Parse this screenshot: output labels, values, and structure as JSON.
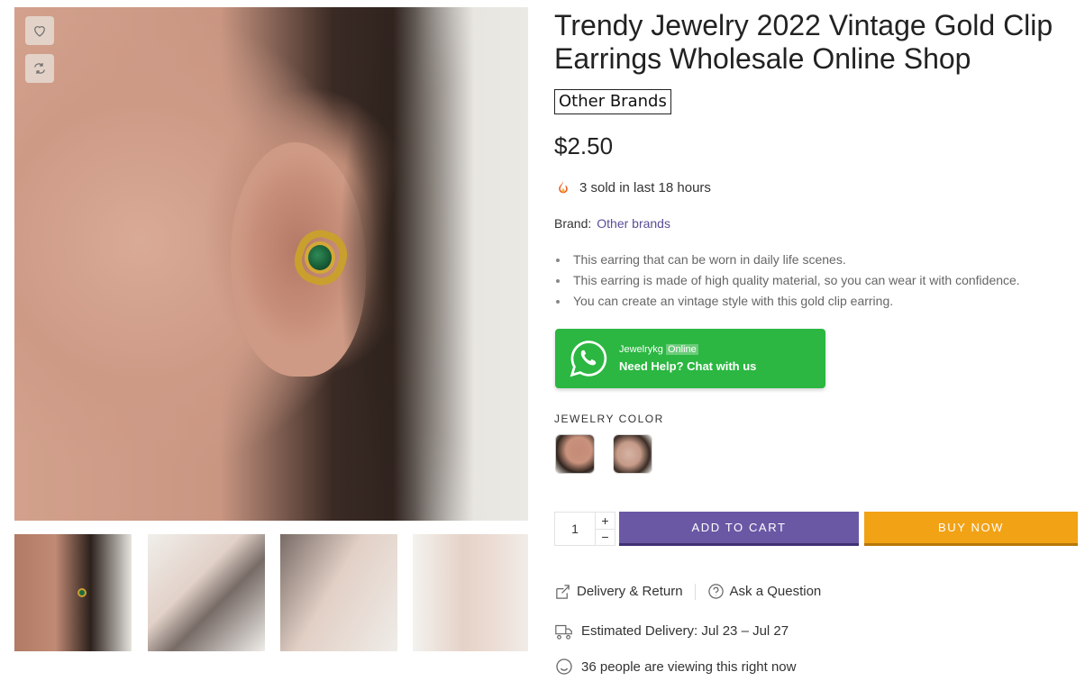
{
  "product": {
    "title": "Trendy Jewelry 2022 Vintage Gold Clip Earrings Wholesale Online Shop",
    "brand_tag": "Other Brands",
    "price": "$2.50",
    "sold_text": "3 sold in last 18 hours",
    "brand_label": "Brand:",
    "brand_link": "Other brands",
    "features": [
      "This earring that can be worn in daily life scenes.",
      "This earring is made of high quality material, so you can wear it with confidence.",
      "You can create an vintage style with this gold clip earring."
    ]
  },
  "gallery": {
    "icons": [
      "heart-icon",
      "compare-icon"
    ],
    "thumbnail_count": 4
  },
  "whatsapp": {
    "name": "Jewelrykg",
    "status": "Online",
    "help_text": "Need Help? Chat with us",
    "color": "#2bb741"
  },
  "variant": {
    "label": "JEWELRY COLOR"
  },
  "purchase": {
    "quantity": "1",
    "plus": "+",
    "minus": "−",
    "add_to_cart": "ADD TO CART",
    "buy_now": "BUY NOW",
    "cart_color": "#6a58a5",
    "buy_color": "#f2a215"
  },
  "extras": {
    "delivery_return": "Delivery & Return",
    "ask_question": "Ask a Question",
    "estimated_delivery": "Estimated Delivery: Jul 23 – Jul 27",
    "viewing": "36 people are viewing this right now"
  }
}
